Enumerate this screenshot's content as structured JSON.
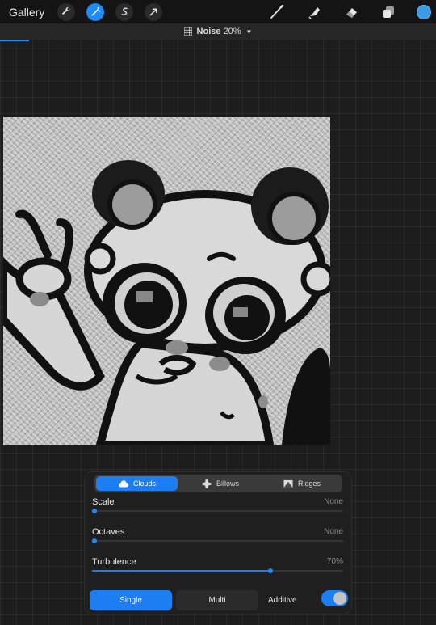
{
  "topbar": {
    "gallery_label": "Gallery",
    "left_tools": [
      "wrench-icon",
      "magic-wand-icon",
      "selection-icon",
      "transform-arrow-icon"
    ],
    "right_tools": [
      "brush-icon",
      "smudge-icon",
      "eraser-icon",
      "layers-icon",
      "color-icon"
    ],
    "active_color": "#3a9be6"
  },
  "adjustment": {
    "name": "Noise",
    "value": "20%",
    "progress": 0.067
  },
  "panel": {
    "modes": [
      {
        "label": "Clouds",
        "icon": "cloud-icon",
        "active": true
      },
      {
        "label": "Billows",
        "icon": "billows-icon",
        "active": false
      },
      {
        "label": "Ridges",
        "icon": "ridges-icon",
        "active": false
      }
    ],
    "sliders": [
      {
        "label": "Scale",
        "value": "None",
        "fraction": 0.0
      },
      {
        "label": "Octaves",
        "value": "None",
        "fraction": 0.0
      },
      {
        "label": "Turbulence",
        "value": "70%",
        "fraction": 0.7
      }
    ],
    "blend": {
      "single_label": "Single",
      "multi_label": "Multi",
      "additive_label": "Additive",
      "additive_on": true
    }
  },
  "colors": {
    "accent": "#1d7ef3",
    "background": "#1d1d1d"
  }
}
